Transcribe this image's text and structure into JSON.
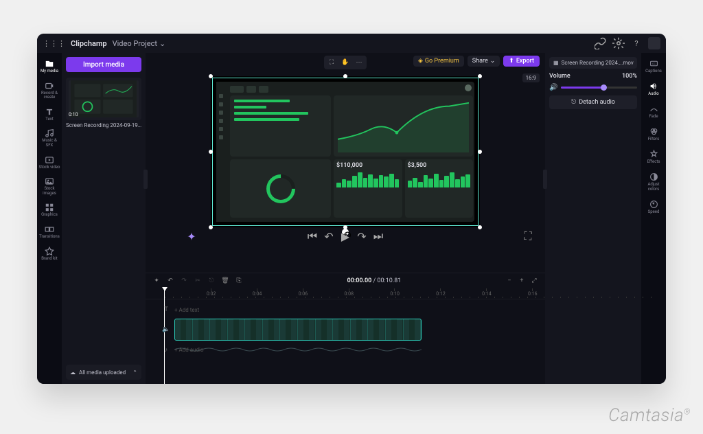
{
  "watermark": {
    "text": "Camtasia"
  },
  "titlebar": {
    "brand": "Clipchamp",
    "project": "Video Project"
  },
  "left_rail": [
    {
      "id": "my-media",
      "label": "My media",
      "active": true
    },
    {
      "id": "record",
      "label": "Record & create"
    },
    {
      "id": "text",
      "label": "Text"
    },
    {
      "id": "music",
      "label": "Music & SFX"
    },
    {
      "id": "stock-video",
      "label": "Stock video"
    },
    {
      "id": "stock-images",
      "label": "Stock images"
    },
    {
      "id": "graphics",
      "label": "Graphics"
    },
    {
      "id": "transitions",
      "label": "Transitions"
    },
    {
      "id": "brand-kit",
      "label": "Brand kit"
    }
  ],
  "media_panel": {
    "import_label": "Import media",
    "clip_name": "Screen Recording 2024-09-19…",
    "clip_duration": "0:10",
    "upload_status": "All media uploaded"
  },
  "stage": {
    "premium_label": "Go Premium",
    "share_label": "Share",
    "export_label": "Export",
    "aspect": "16:9",
    "dashboard": {
      "stat1": "$110,000",
      "stat2": "$3,500"
    }
  },
  "timeline": {
    "time_current": "00:00.00",
    "time_total": "00:10.81",
    "add_text_placeholder": "+ Add text",
    "add_audio_placeholder": "+ Add audio",
    "ruler_labels": [
      "0:02",
      "0:04",
      "0:06",
      "0:08",
      "0:10",
      "0:12",
      "0:14",
      "0:16"
    ]
  },
  "right_panel": {
    "clip_label": "Screen Recording 2024….mov",
    "volume_label": "Volume",
    "volume_value": "100%",
    "detach_label": "Detach audio"
  },
  "prop_rail": [
    {
      "id": "captions",
      "label": "Captions"
    },
    {
      "id": "audio",
      "label": "Audio",
      "active": true
    },
    {
      "id": "fade",
      "label": "Fade"
    },
    {
      "id": "filters",
      "label": "Filters"
    },
    {
      "id": "effects",
      "label": "Effects"
    },
    {
      "id": "adjust-colors",
      "label": "Adjust colors"
    },
    {
      "id": "speed",
      "label": "Speed"
    }
  ]
}
